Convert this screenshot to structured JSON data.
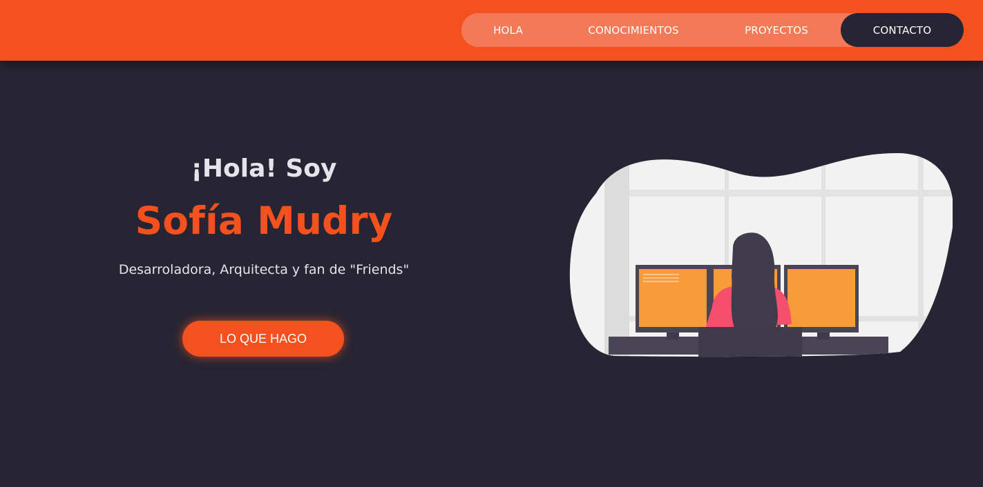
{
  "nav": {
    "items": [
      {
        "label": "HOLA"
      },
      {
        "label": "CONOCIMIENTOS"
      },
      {
        "label": "PROYECTOS"
      },
      {
        "label": "CONTACTO"
      }
    ],
    "active": "CONTACTO"
  },
  "hero": {
    "greeting": "¡Hola! Soy",
    "name": "Sofía Mudry",
    "tagline": "Desarroladora, Arquitecta y fan de \"Friends\"",
    "cta_label": "LO QUE HAGO"
  },
  "illustration": {
    "icon": "woman-at-computers-illustration"
  },
  "colors": {
    "brand": "#f4511e",
    "nav_pill": "#f47a57",
    "background": "#272533",
    "text_light": "#e6e4ea",
    "screen": "#f99b3b",
    "shirt": "#f4506b"
  }
}
